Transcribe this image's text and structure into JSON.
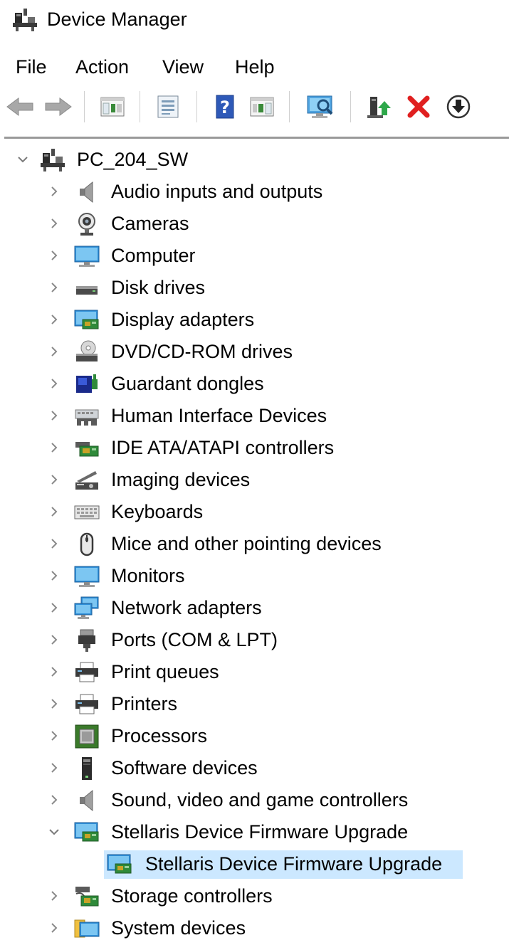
{
  "window": {
    "title": "Device Manager",
    "icon": "device-manager-icon"
  },
  "menu": [
    "File",
    "Action",
    "View",
    "Help"
  ],
  "toolbar": [
    {
      "name": "back-button",
      "icon": "back-arrow-icon",
      "enabled": false
    },
    {
      "name": "forward-button",
      "icon": "forward-arrow-icon",
      "enabled": false
    },
    {
      "name": "show-hide-console-tree-button",
      "icon": "console-tree-icon"
    },
    {
      "name": "properties-button",
      "icon": "properties-icon"
    },
    {
      "name": "help-button",
      "icon": "help-icon"
    },
    {
      "name": "show-action-pane-button",
      "icon": "action-pane-icon"
    },
    {
      "name": "scan-hardware-changes-button",
      "icon": "scan-monitor-icon"
    },
    {
      "name": "update-driver-button",
      "icon": "update-driver-icon"
    },
    {
      "name": "uninstall-device-button",
      "icon": "red-x-icon"
    },
    {
      "name": "disable-device-button",
      "icon": "down-arrow-circle-icon"
    }
  ],
  "tree": {
    "root": {
      "label": "PC_204_SW",
      "icon": "computer-tree-icon",
      "expanded": true
    },
    "categories": [
      {
        "label": "Audio inputs and outputs",
        "icon": "speaker-icon"
      },
      {
        "label": "Cameras",
        "icon": "webcam-icon"
      },
      {
        "label": "Computer",
        "icon": "monitor-icon"
      },
      {
        "label": "Disk drives",
        "icon": "disk-drive-icon"
      },
      {
        "label": "Display adapters",
        "icon": "display-adapter-icon"
      },
      {
        "label": "DVD/CD-ROM drives",
        "icon": "dvd-drive-icon"
      },
      {
        "label": "Guardant dongles",
        "icon": "dongle-icon"
      },
      {
        "label": "Human Interface Devices",
        "icon": "hid-icon"
      },
      {
        "label": "IDE ATA/ATAPI controllers",
        "icon": "ide-controller-icon"
      },
      {
        "label": "Imaging devices",
        "icon": "scanner-icon"
      },
      {
        "label": "Keyboards",
        "icon": "keyboard-icon"
      },
      {
        "label": "Mice and other pointing devices",
        "icon": "mouse-icon"
      },
      {
        "label": "Monitors",
        "icon": "monitor-icon"
      },
      {
        "label": "Network adapters",
        "icon": "network-adapter-icon"
      },
      {
        "label": "Ports (COM & LPT)",
        "icon": "port-plug-icon"
      },
      {
        "label": "Print queues",
        "icon": "printer-icon"
      },
      {
        "label": "Printers",
        "icon": "printer-icon"
      },
      {
        "label": "Processors",
        "icon": "processor-icon"
      },
      {
        "label": "Software devices",
        "icon": "software-device-icon"
      },
      {
        "label": "Sound, video and game controllers",
        "icon": "speaker-icon"
      },
      {
        "label": "Stellaris Device Firmware Upgrade",
        "icon": "display-adapter-icon",
        "expanded": true,
        "children": [
          {
            "label": "Stellaris Device Firmware Upgrade",
            "icon": "display-adapter-icon",
            "selected": true
          }
        ]
      },
      {
        "label": "Storage controllers",
        "icon": "storage-controller-icon"
      },
      {
        "label": "System devices",
        "icon": "system-devices-icon"
      }
    ]
  },
  "colors": {
    "selection": "#cce8ff",
    "chevron": "#7a7a7a",
    "text": "#000000"
  }
}
